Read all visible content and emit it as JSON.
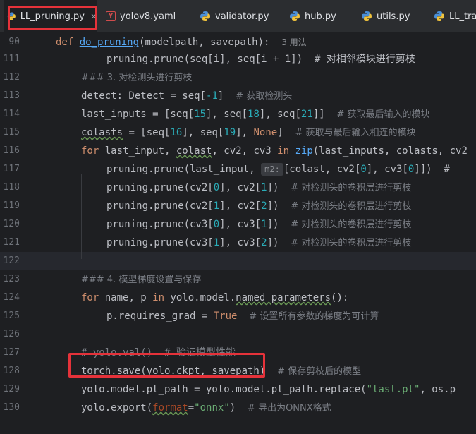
{
  "tabs": [
    {
      "label": "LL_pruning.py",
      "type": "py",
      "active": true
    },
    {
      "label": "yolov8.yaml",
      "type": "yaml"
    },
    {
      "label": "validator.py",
      "type": "py"
    },
    {
      "label": "hub.py",
      "type": "py"
    },
    {
      "label": "utils.py",
      "type": "py"
    },
    {
      "label": "LL_trai",
      "type": "py"
    }
  ],
  "tab_close_glyph": "×",
  "sticky": {
    "line_no": "90",
    "kw_def": "def",
    "fn_name": "do_pruning",
    "params": "(modelpath, savepath):",
    "usages": "3 用法"
  },
  "lines": [
    {
      "n": "111",
      "text": "pruning.prune(seq[i], seq[i + 1])  # 对相邻模块进行剪枝"
    },
    {
      "n": "112",
      "comment": "### 3. 对检测头进行剪枝"
    },
    {
      "n": "113",
      "a": "detect: Detect = seq[",
      "b": "-1",
      "c": "]  ",
      "cm": "# 获取检测头"
    },
    {
      "n": "114",
      "a": "last_inputs = [seq[",
      "n1": "15",
      "b": "], seq[",
      "n2": "18",
      "c": "], seq[",
      "n3": "21",
      "d": "]]  ",
      "cm": "# 获取最后输入的模块"
    },
    {
      "n": "115",
      "u": "colasts",
      "a": " = [seq[",
      "n1": "16",
      "b": "], seq[",
      "n2": "19",
      "c": "], ",
      "kw": "None",
      "d": "]  ",
      "cm": "# 获取与最后输入相连的模块"
    },
    {
      "n": "116",
      "kw": "for",
      "a": " last_input, ",
      "u": "colast",
      "b": ", cv2, cv3 ",
      "kw2": "in",
      "fn": " zip",
      "c": "(last_inputs, colasts, cv2"
    },
    {
      "n": "117",
      "a": "pruning.prune(last_input, ",
      "hint": "m2:",
      "b": "[colast, cv2[",
      "n1": "0",
      "c": "], cv3[",
      "n2": "0",
      "d": "]])  #"
    },
    {
      "n": "118",
      "a": "pruning.prune(cv2[",
      "n1": "0",
      "b": "], cv2[",
      "n2": "1",
      "c": "])  ",
      "cm": "# 对检测头的卷积层进行剪枝"
    },
    {
      "n": "119",
      "a": "pruning.prune(cv2[",
      "n1": "1",
      "b": "], cv2[",
      "n2": "2",
      "c": "])  ",
      "cm": "# 对检测头的卷积层进行剪枝"
    },
    {
      "n": "120",
      "a": "pruning.prune(cv3[",
      "n1": "0",
      "b": "], cv3[",
      "n2": "1",
      "c": "])  ",
      "cm": "# 对检测头的卷积层进行剪枝"
    },
    {
      "n": "121",
      "a": "pruning.prune(cv3[",
      "n1": "1",
      "b": "], cv3[",
      "n2": "2",
      "c": "])  ",
      "cm": "# 对检测头的卷积层进行剪枝"
    },
    {
      "n": "122"
    },
    {
      "n": "123",
      "comment": "### 4. 模型梯度设置与保存"
    },
    {
      "n": "124",
      "kw": "for",
      "a": " name, p ",
      "kw2": "in",
      "b": " yolo.model.",
      "u": "named_parameters",
      "c": "():"
    },
    {
      "n": "125",
      "a": "p.requires_grad = ",
      "kw": "True",
      "b": "  ",
      "cm": "# 设置所有参数的梯度为可计算"
    },
    {
      "n": "126"
    },
    {
      "n": "127",
      "comment": "# yolo.val()  # 验证模型性能"
    },
    {
      "n": "128",
      "a": "torch.save(yolo.ckpt, savepath)  ",
      "cm": "# 保存剪枝后的模型"
    },
    {
      "n": "129",
      "a": "yolo.model.pt_path = yolo.model.pt_path.replace(",
      "str": "\"last.pt\"",
      "b": ", os.p"
    },
    {
      "n": "130",
      "a": "yolo.export(",
      "named": "format",
      "b": "=",
      "str": "\"onnx\"",
      "c": ")  ",
      "cm": "# 导出为ONNX格式"
    }
  ],
  "colors": {
    "highlight": "#e5323a",
    "keyword": "#cf8e6d",
    "function": "#56a8f5",
    "number": "#2aacb8",
    "string": "#6aab73",
    "comment": "#7a7e85"
  }
}
